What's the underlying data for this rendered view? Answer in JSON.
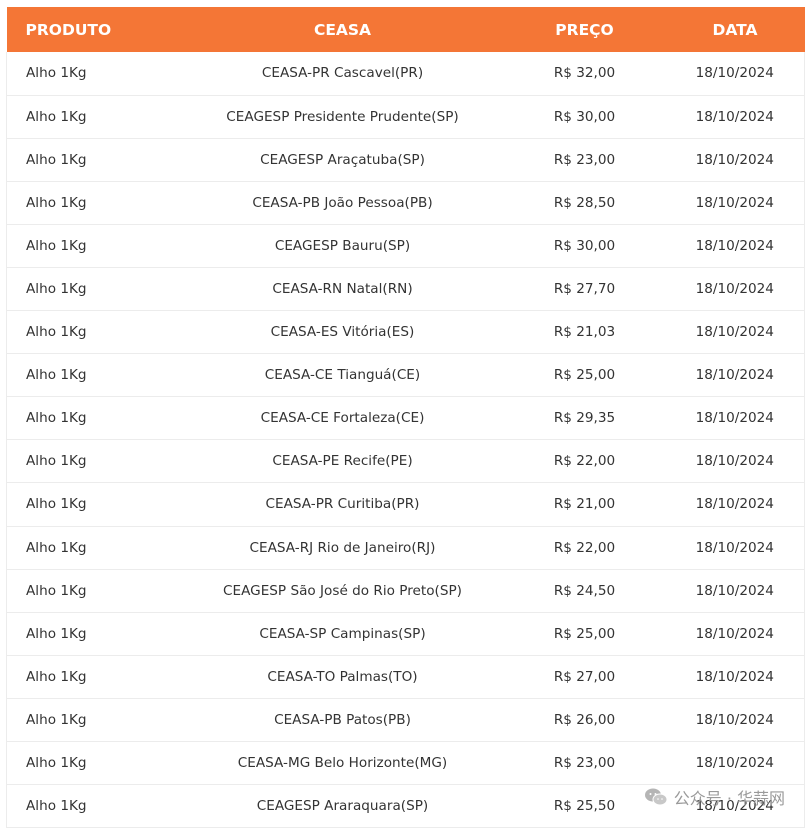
{
  "table": {
    "headers": {
      "produto": "PRODUTO",
      "ceasa": "CEASA",
      "preco": "PREÇO",
      "data": "DATA"
    },
    "rows": [
      {
        "produto": "Alho 1Kg",
        "ceasa": "CEASA-PR Cascavel(PR)",
        "preco": "R$ 32,00",
        "data": "18/10/2024"
      },
      {
        "produto": "Alho 1Kg",
        "ceasa": "CEAGESP Presidente Prudente(SP)",
        "preco": "R$ 30,00",
        "data": "18/10/2024"
      },
      {
        "produto": "Alho 1Kg",
        "ceasa": "CEAGESP Araçatuba(SP)",
        "preco": "R$ 23,00",
        "data": "18/10/2024"
      },
      {
        "produto": "Alho 1Kg",
        "ceasa": "CEASA-PB João Pessoa(PB)",
        "preco": "R$ 28,50",
        "data": "18/10/2024"
      },
      {
        "produto": "Alho 1Kg",
        "ceasa": "CEAGESP Bauru(SP)",
        "preco": "R$ 30,00",
        "data": "18/10/2024"
      },
      {
        "produto": "Alho 1Kg",
        "ceasa": "CEASA-RN Natal(RN)",
        "preco": "R$ 27,70",
        "data": "18/10/2024"
      },
      {
        "produto": "Alho 1Kg",
        "ceasa": "CEASA-ES Vitória(ES)",
        "preco": "R$ 21,03",
        "data": "18/10/2024"
      },
      {
        "produto": "Alho 1Kg",
        "ceasa": "CEASA-CE Tianguá(CE)",
        "preco": "R$ 25,00",
        "data": "18/10/2024"
      },
      {
        "produto": "Alho 1Kg",
        "ceasa": "CEASA-CE Fortaleza(CE)",
        "preco": "R$ 29,35",
        "data": "18/10/2024"
      },
      {
        "produto": "Alho 1Kg",
        "ceasa": "CEASA-PE Recife(PE)",
        "preco": "R$ 22,00",
        "data": "18/10/2024"
      },
      {
        "produto": "Alho 1Kg",
        "ceasa": "CEASA-PR Curitiba(PR)",
        "preco": "R$ 21,00",
        "data": "18/10/2024"
      },
      {
        "produto": "Alho 1Kg",
        "ceasa": "CEASA-RJ Rio de Janeiro(RJ)",
        "preco": "R$ 22,00",
        "data": "18/10/2024"
      },
      {
        "produto": "Alho 1Kg",
        "ceasa": "CEAGESP São José do Rio Preto(SP)",
        "preco": "R$ 24,50",
        "data": "18/10/2024"
      },
      {
        "produto": "Alho 1Kg",
        "ceasa": "CEASA-SP Campinas(SP)",
        "preco": "R$ 25,00",
        "data": "18/10/2024"
      },
      {
        "produto": "Alho 1Kg",
        "ceasa": "CEASA-TO Palmas(TO)",
        "preco": "R$ 27,00",
        "data": "18/10/2024"
      },
      {
        "produto": "Alho 1Kg",
        "ceasa": "CEASA-PB Patos(PB)",
        "preco": "R$ 26,00",
        "data": "18/10/2024"
      },
      {
        "produto": "Alho 1Kg",
        "ceasa": "CEASA-MG Belo Horizonte(MG)",
        "preco": "R$ 23,00",
        "data": "18/10/2024"
      },
      {
        "produto": "Alho 1Kg",
        "ceasa": "CEAGESP Araraquara(SP)",
        "preco": "R$ 25,50",
        "data": "18/10/2024"
      }
    ]
  },
  "watermark": {
    "text": "公众号 · 华蒜网",
    "icon": "wechat-icon"
  },
  "colors": {
    "header_bg": "#f47636",
    "header_text": "#ffffff",
    "row_border": "#ececec"
  }
}
